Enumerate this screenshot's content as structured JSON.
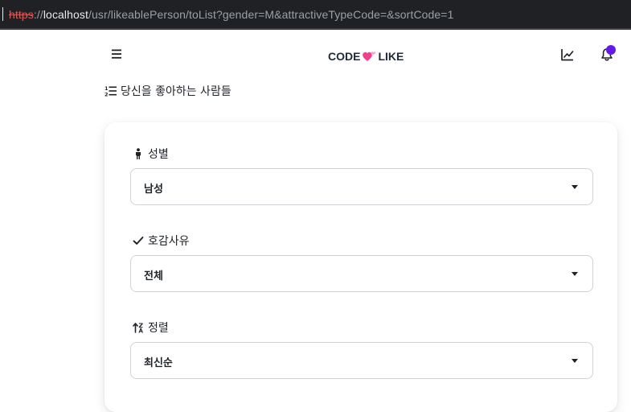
{
  "browser": {
    "url_scheme": "https",
    "url_separator": "://",
    "url_host": "localhost",
    "url_path": "/usr/likeablePerson/toList?gender=M&attractiveTypeCode=&sortCode=1"
  },
  "navbar": {
    "logo_left": "CODE",
    "logo_right": "LIKE",
    "menu_icon": "hamburger-icon",
    "chart_icon": "line-chart-icon",
    "bell_icon": "bell-icon",
    "notification_dot_color": "#6419e6"
  },
  "page": {
    "title": "당신을 좋아하는 사람들",
    "title_icon": "list-ordered-icon"
  },
  "filters": {
    "gender": {
      "label": "성별",
      "icon": "person-icon",
      "value": "남성"
    },
    "reason": {
      "label": "호감사유",
      "icon": "check-icon",
      "value": "전체"
    },
    "sort": {
      "label": "정렬",
      "icon": "sort-icon",
      "value": "최신순"
    }
  },
  "colors": {
    "accent": "#6419e6",
    "heart_pink": "#f43f8e",
    "url_scheme_red": "#d45d5d"
  }
}
